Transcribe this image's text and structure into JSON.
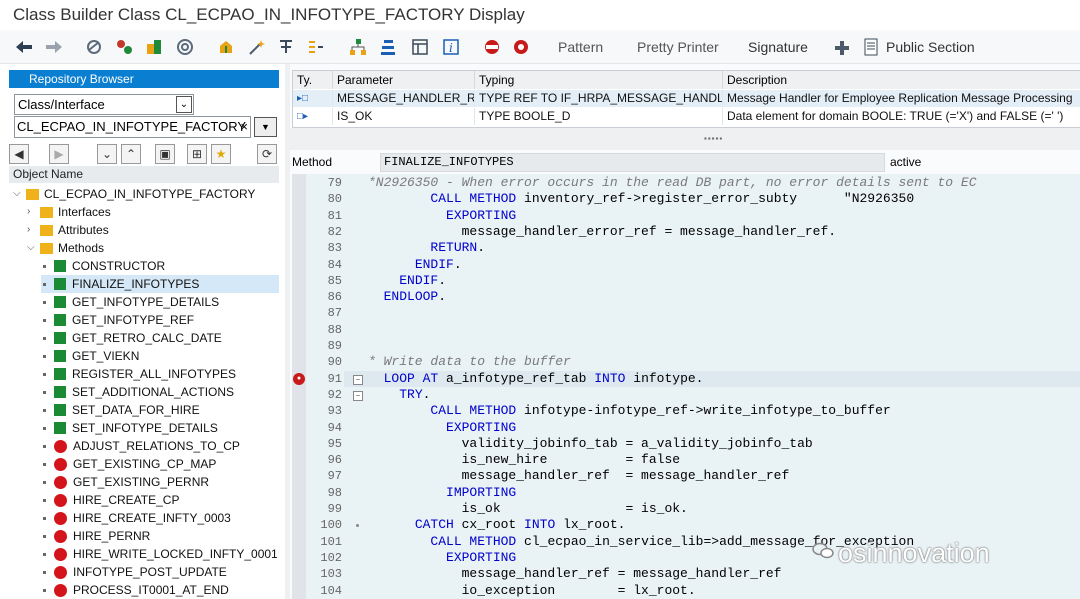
{
  "window": {
    "title": "Class Builder Class CL_ECPAO_IN_INFOTYPE_FACTORY Display"
  },
  "toolbar": {
    "pattern": "Pattern",
    "pretty_printer": "Pretty Printer",
    "signature": "Signature",
    "public_section": "Public Section"
  },
  "left": {
    "repo_title": "Repository Browser",
    "object_type": "Class/Interface",
    "object_name": "CL_ECPAO_IN_INFOTYPE_FACTORY",
    "object_header": "Object Name",
    "tree": {
      "root": "CL_ECPAO_IN_INFOTYPE_FACTORY",
      "folders": [
        "Interfaces",
        "Attributes",
        "Methods"
      ],
      "methods_green": [
        "CONSTRUCTOR",
        "FINALIZE_INFOTYPES",
        "GET_INFOTYPE_DETAILS",
        "GET_INFOTYPE_REF",
        "GET_RETRO_CALC_DATE",
        "GET_VIEKN",
        "REGISTER_ALL_INFOTYPES",
        "SET_ADDITIONAL_ACTIONS",
        "SET_DATA_FOR_HIRE",
        "SET_INFOTYPE_DETAILS"
      ],
      "methods_red": [
        "ADJUST_RELATIONS_TO_CP",
        "GET_EXISTING_CP_MAP",
        "GET_EXISTING_PERNR",
        "HIRE_CREATE_CP",
        "HIRE_CREATE_INFTY_0003",
        "HIRE_PERNR",
        "HIRE_WRITE_LOCKED_INFTY_0001",
        "INFOTYPE_POST_UPDATE",
        "PROCESS_IT0001_AT_END"
      ]
    }
  },
  "params": {
    "headers": [
      "Ty.",
      "Parameter",
      "Typing",
      "Description"
    ],
    "rows": [
      {
        "param": "MESSAGE_HANDLER_REF",
        "typing": "TYPE REF TO IF_HRPA_MESSAGE_HANDLER",
        "desc": "Message Handler for Employee Replication Message Processing"
      },
      {
        "param": "IS_OK",
        "typing": "TYPE BOOLE_D",
        "desc": "Data element for domain BOOLE: TRUE (='X') and FALSE (=' ')"
      }
    ]
  },
  "method": {
    "label": "Method",
    "name": "FINALIZE_INFOTYPES",
    "status": "active"
  },
  "code_lines": [
    [
      "79",
      "*N2926350 - When error occurs in the read DB part, no error details sent to EC"
    ],
    [
      "80",
      "        CALL METHOD inventory_ref->register_error_subty      \"N2926350"
    ],
    [
      "81",
      "          EXPORTING"
    ],
    [
      "82",
      "            message_handler_error_ref = message_handler_ref."
    ],
    [
      "83",
      "        RETURN."
    ],
    [
      "84",
      "      ENDIF."
    ],
    [
      "85",
      "    ENDIF."
    ],
    [
      "86",
      "  ENDLOOP."
    ],
    [
      "87",
      ""
    ],
    [
      "88",
      ""
    ],
    [
      "89",
      ""
    ],
    [
      "90",
      "* Write data to the buffer"
    ],
    [
      "91",
      "  LOOP AT a_infotype_ref_tab INTO infotype."
    ],
    [
      "92",
      "    TRY."
    ],
    [
      "93",
      "        CALL METHOD infotype-infotype_ref->write_infotype_to_buffer"
    ],
    [
      "94",
      "          EXPORTING"
    ],
    [
      "95",
      "            validity_jobinfo_tab = a_validity_jobinfo_tab"
    ],
    [
      "96",
      "            is_new_hire          = false"
    ],
    [
      "97",
      "            message_handler_ref  = message_handler_ref"
    ],
    [
      "98",
      "          IMPORTING"
    ],
    [
      "99",
      "            is_ok                = is_ok."
    ],
    [
      "100",
      "      CATCH cx_root INTO lx_root."
    ],
    [
      "101",
      "        CALL METHOD cl_ecpao_in_service_lib=>add_message_for_exception"
    ],
    [
      "102",
      "          EXPORTING"
    ],
    [
      "103",
      "            message_handler_ref = message_handler_ref"
    ],
    [
      "104",
      "            io_exception        = lx_root."
    ]
  ],
  "watermark": "osinnovation"
}
